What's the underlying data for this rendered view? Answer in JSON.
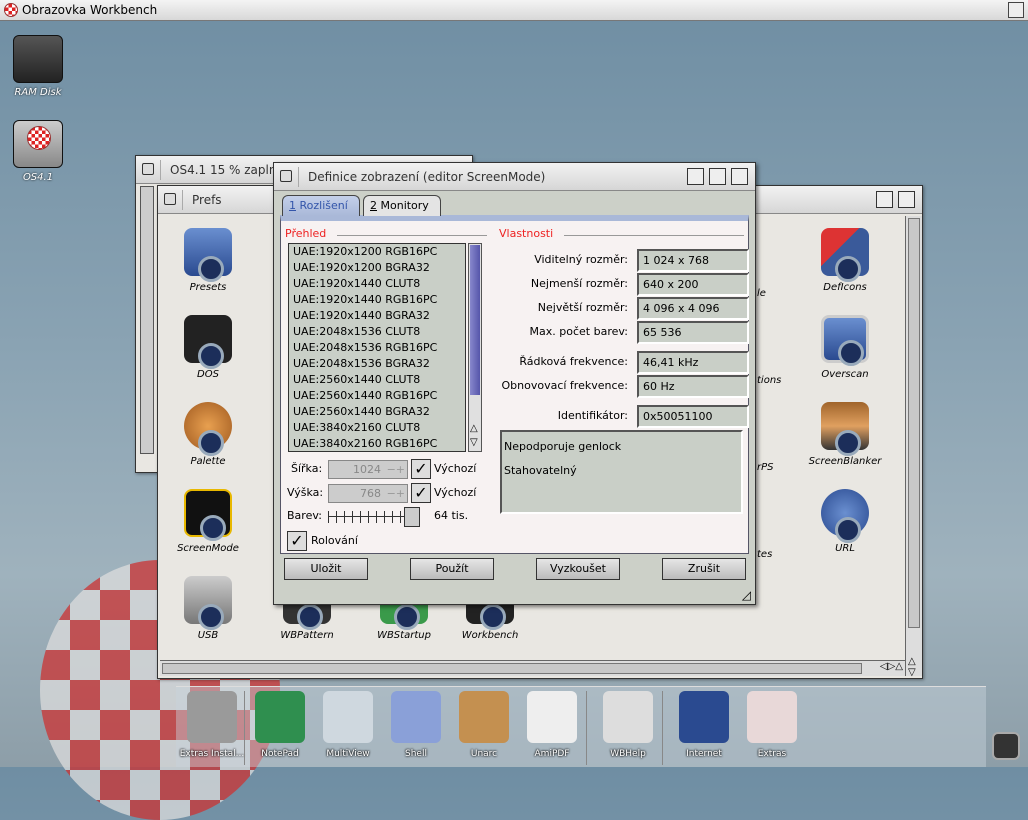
{
  "screen": {
    "title": "Obrazovka Workbench"
  },
  "desktop": [
    {
      "label": "RAM Disk",
      "icon": "ram-disk-icon"
    },
    {
      "label": "OS4.1",
      "icon": "os41-drive-icon"
    }
  ],
  "os41_window": {
    "title": "OS4.1  15 % zapln"
  },
  "prefs_window": {
    "title": "Prefs",
    "icons": [
      {
        "label": "Presets"
      },
      {
        "label": "DOS"
      },
      {
        "label": "Palette"
      },
      {
        "label": "ScreenMode"
      },
      {
        "label": "USB"
      },
      {
        "label": "WBPattern"
      },
      {
        "label": "WBStartup"
      },
      {
        "label": "Workbench"
      },
      {
        "label": "DefIcons"
      },
      {
        "label": "Overscan"
      },
      {
        "label": "ScreenBlanker"
      },
      {
        "label": "URL"
      }
    ],
    "partial_labels": [
      "le",
      "tions",
      "rPS",
      "tes"
    ]
  },
  "dialog": {
    "title": "Definice zobrazení (editor ScreenMode)",
    "tabs": [
      {
        "num": "1",
        "label": " Rozlišení",
        "active": true
      },
      {
        "num": "2",
        "label": " Monitory",
        "active": false
      }
    ],
    "overview_label": "Přehled",
    "modes": [
      "UAE:1920x1200 RGB16PC",
      "UAE:1920x1200 BGRA32",
      "UAE:1920x1440 CLUT8",
      "UAE:1920x1440 RGB16PC",
      "UAE:1920x1440 BGRA32",
      "UAE:2048x1536 CLUT8",
      "UAE:2048x1536 RGB16PC",
      "UAE:2048x1536 BGRA32",
      "UAE:2560x1440 CLUT8",
      "UAE:2560x1440 RGB16PC",
      "UAE:2560x1440 BGRA32",
      "UAE:3840x2160 CLUT8",
      "UAE:3840x2160 RGB16PC"
    ],
    "width_label": "Šířka:",
    "width_value": "1024",
    "width_default": "Výchozí",
    "height_label": "Výška:",
    "height_value": "768",
    "height_default": "Výchozí",
    "colors_label": "Barev:",
    "colors_value": "64 tis.",
    "colors_slider_fraction": 1.0,
    "scroll_label": "Rolování",
    "scroll_checked": true,
    "properties_label": "Vlastnosti",
    "properties": [
      {
        "label": "Viditelný rozměr:",
        "value": "1 024 x 768"
      },
      {
        "label": "Nejmenší rozměr:",
        "value": "640 x 200"
      },
      {
        "label": "Největší rozměr:",
        "value": "4 096 x 4 096"
      },
      {
        "label": "Max. počet barev:",
        "value": "65 536"
      },
      {
        "label": "Řádková frekvence:",
        "value": "46,41 kHz"
      },
      {
        "label": "Obnovovací frekvence:",
        "value": "60 Hz"
      },
      {
        "label": "Identifikátor:",
        "value": "0x50051100"
      }
    ],
    "notes": [
      "Nepodporuje genlock",
      "Stahovatelný"
    ],
    "buttons": {
      "save": "Uložit",
      "use": "Použít",
      "test": "Vyzkoušet",
      "cancel": "Zrušit"
    }
  },
  "dock": [
    "Extras Instal...",
    "NotePad",
    "MultiView",
    "Shell",
    "Unarc",
    "AmiPDF",
    "WBHelp",
    "Internet",
    "Extras"
  ],
  "colors": {
    "accent_red": "#e22222",
    "tab_blue": "#a9b8d8"
  }
}
